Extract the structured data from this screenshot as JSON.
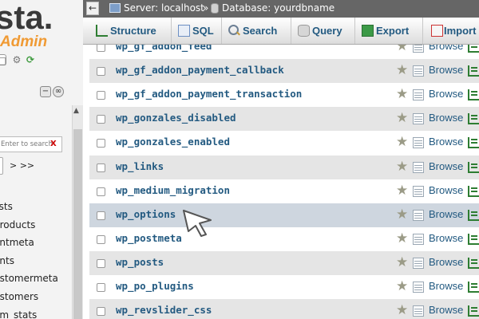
{
  "app": {
    "logo_text": "sta.",
    "logo_sub": "Admin"
  },
  "sidebar": {
    "filter_placeholder": "Enter to search",
    "filter_clear": "X",
    "pager_next": "> >>",
    "tables": [
      "lists",
      "products",
      "entmeta",
      "ents",
      "ustomermeta",
      "ustomers",
      "om_stats"
    ]
  },
  "breadcrumb": {
    "back": "←",
    "server": "Server: localhost",
    "separator": "»",
    "database": "Database: yourdbname"
  },
  "tabs": [
    {
      "label": "Structure",
      "icon": "structure-icon"
    },
    {
      "label": "SQL",
      "icon": "sql-icon"
    },
    {
      "label": "Search",
      "icon": "search-icon"
    },
    {
      "label": "Query",
      "icon": "query-icon"
    },
    {
      "label": "Export",
      "icon": "export-icon"
    },
    {
      "label": "Import",
      "icon": "import-icon"
    }
  ],
  "table_list": {
    "browse_label": "Browse",
    "rows": [
      {
        "name": "wp_gf_addon_feed"
      },
      {
        "name": "wp_gf_addon_payment_callback"
      },
      {
        "name": "wp_gf_addon_payment_transaction"
      },
      {
        "name": "wp_gonzales_disabled"
      },
      {
        "name": "wp_gonzales_enabled"
      },
      {
        "name": "wp_links"
      },
      {
        "name": "wp_medium_migration"
      },
      {
        "name": "wp_options"
      },
      {
        "name": "wp_postmeta"
      },
      {
        "name": "wp_posts"
      },
      {
        "name": "wp_po_plugins"
      },
      {
        "name": "wp_revslider_css"
      }
    ]
  },
  "colors": {
    "link": "#235a81",
    "topbar": "#666666",
    "row_alt": "#e5e5e5",
    "row_hover": "#ced6df",
    "logo_accent": "#f09a33"
  }
}
